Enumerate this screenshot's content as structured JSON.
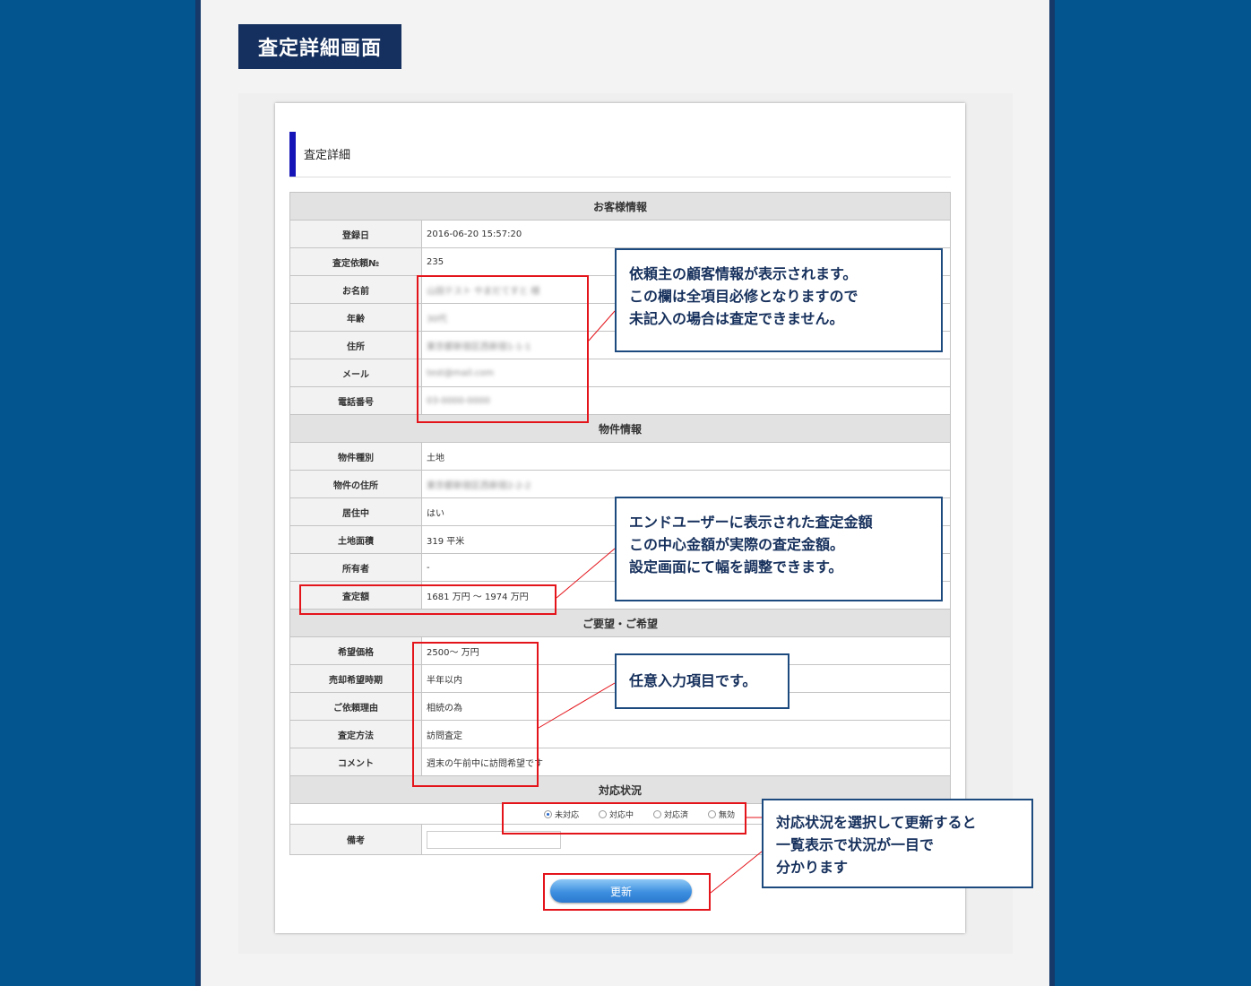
{
  "page_title": "査定詳細画面",
  "section_title": "査定詳細",
  "customer": {
    "header": "お客様情報",
    "rows": [
      {
        "label": "登録日",
        "value": "2016-06-20 15:57:20"
      },
      {
        "label": "査定依頼№",
        "value": "235"
      },
      {
        "label": "お名前",
        "value": "山田テスト やまだてすと 様"
      },
      {
        "label": "年齢",
        "value": "30代"
      },
      {
        "label": "住所",
        "value": "東京都新宿区西新宿1-1-1"
      },
      {
        "label": "メール",
        "value": "test@mail.com"
      },
      {
        "label": "電話番号",
        "value": "03-0000-0000"
      }
    ]
  },
  "property": {
    "header": "物件情報",
    "rows": [
      {
        "label": "物件種別",
        "value": "土地"
      },
      {
        "label": "物件の住所",
        "value": "東京都新宿区西新宿2-2-2"
      },
      {
        "label": "居住中",
        "value": "はい"
      },
      {
        "label": "土地面積",
        "value": "319 平米"
      },
      {
        "label": "所有者",
        "value": "-"
      },
      {
        "label": "査定額",
        "value": "1681 万円 ～ 1974 万円"
      }
    ]
  },
  "request": {
    "header": "ご要望・ご希望",
    "rows": [
      {
        "label": "希望価格",
        "value": "2500～ 万円"
      },
      {
        "label": "売却希望時期",
        "value": "半年以内"
      },
      {
        "label": "ご依頼理由",
        "value": "相続の為"
      },
      {
        "label": "査定方法",
        "value": "訪問査定"
      },
      {
        "label": "コメント",
        "value": "週末の午前中に訪問希望です"
      }
    ]
  },
  "status": {
    "header": "対応状況",
    "options": [
      "未対応",
      "対応中",
      "対応済",
      "無効"
    ],
    "selected": "未対応",
    "note_label": "備考",
    "note_value": ""
  },
  "update_button": "更新",
  "callouts": {
    "customer": [
      "依頼主の顧客情報が表示されます。",
      "この欄は全項目必修となりますので",
      "未記入の場合は査定できません。"
    ],
    "assessment": [
      "エンドユーザーに表示された査定金額",
      "この中心金額が実際の査定金額。",
      "設定画面にて幅を調整できます。"
    ],
    "optional": [
      "任意入力項目です。"
    ],
    "status": [
      "対応状況を選択して更新すると",
      "一覧表示で状況が一目で",
      "分かります"
    ]
  },
  "colors": {
    "background": "#02558f",
    "title_bar": "#15305e",
    "section_accent": "#1515b7",
    "highlight": "#e4141b",
    "callout_border": "#1d4a7e"
  }
}
